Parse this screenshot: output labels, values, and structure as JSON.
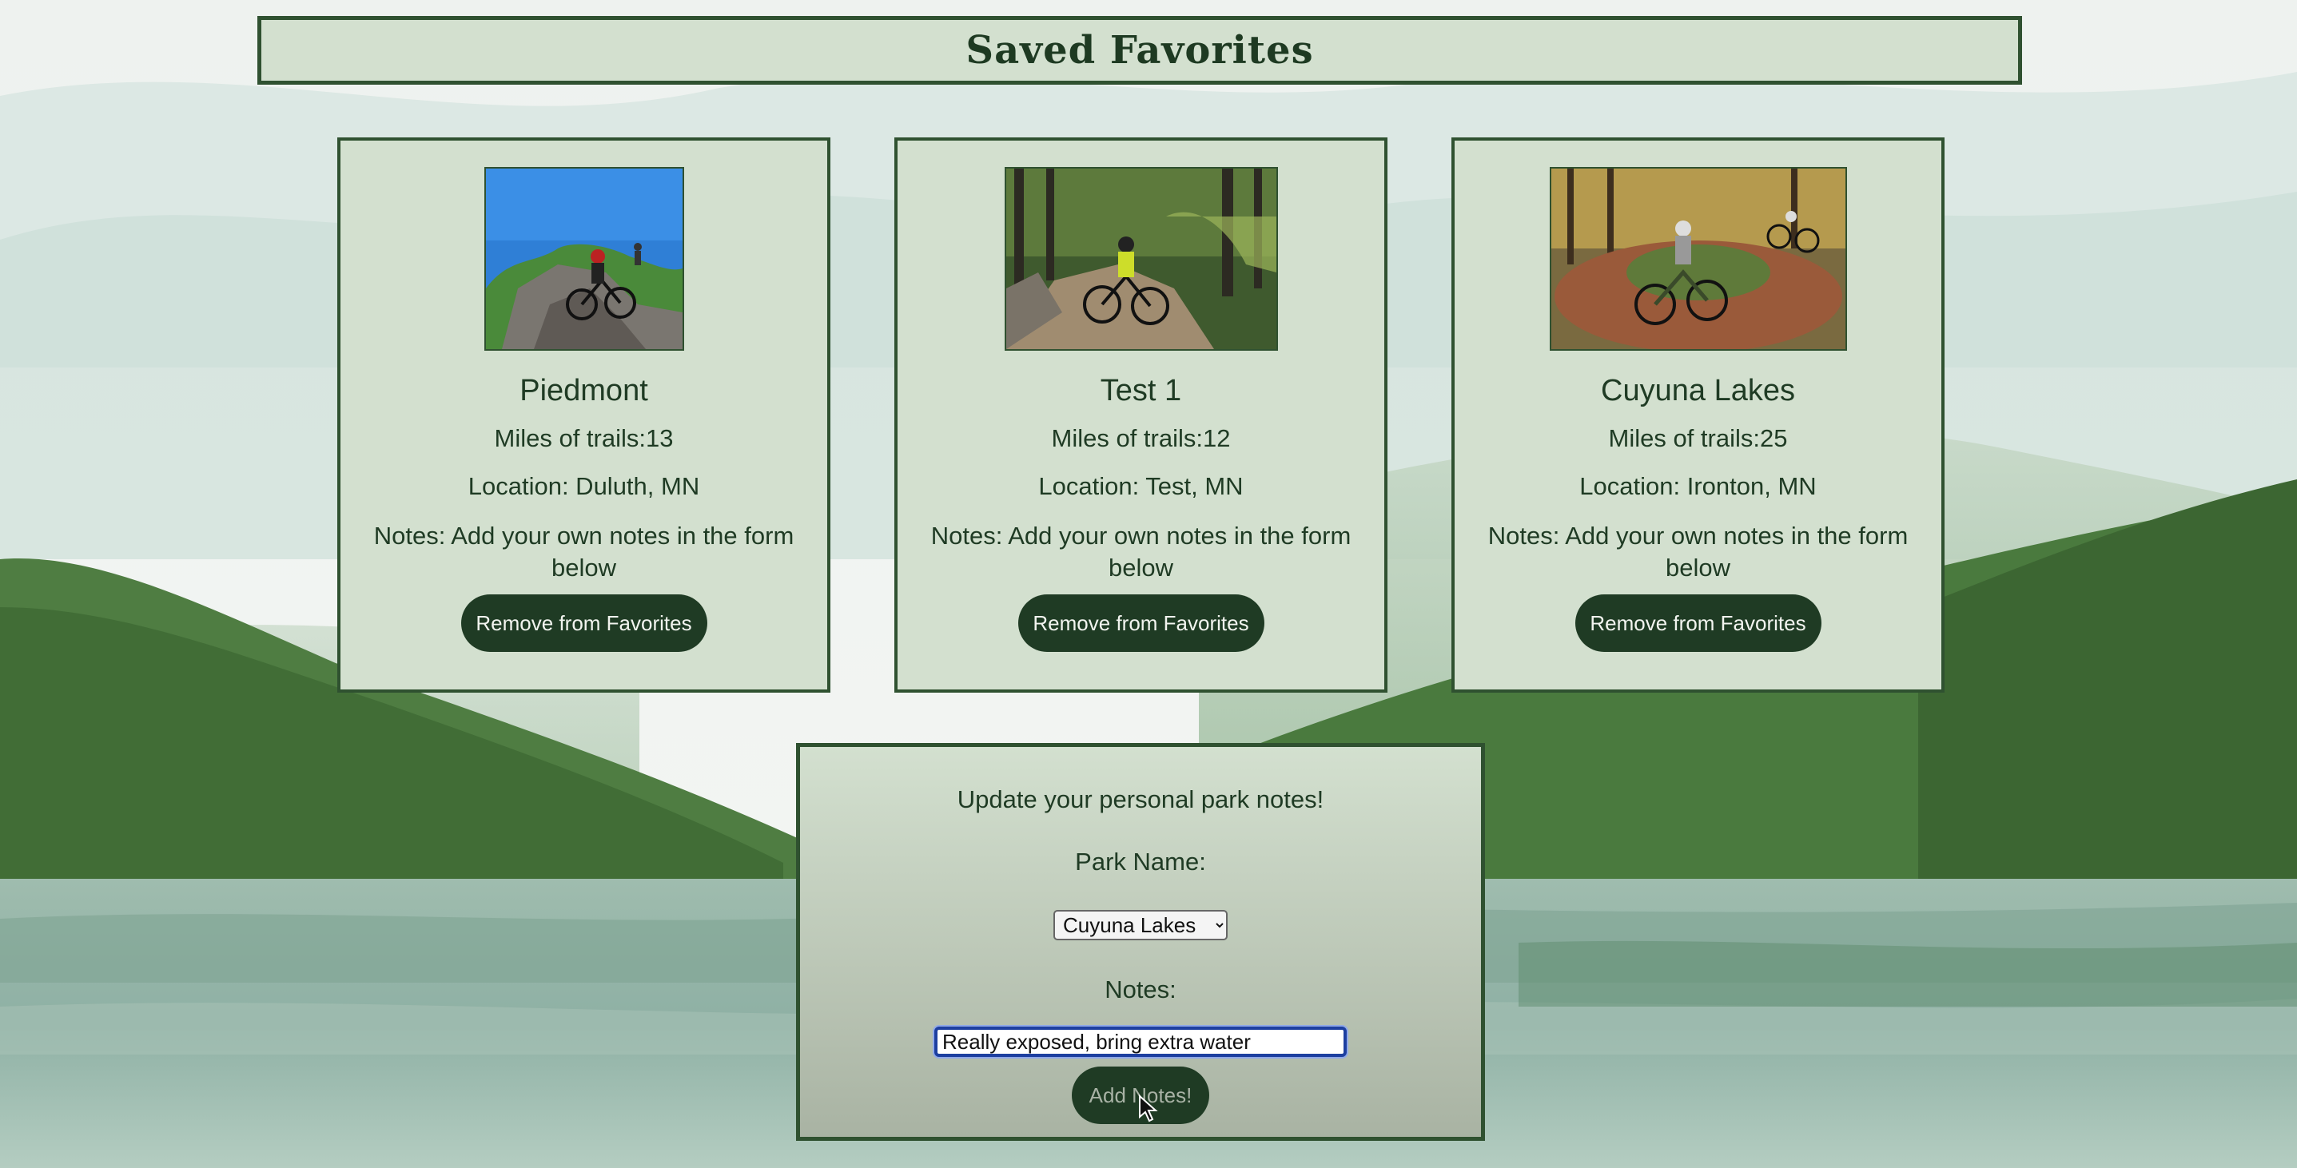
{
  "header": {
    "title": "Saved Favorites"
  },
  "cards": [
    {
      "name": "Piedmont",
      "miles": "Miles of trails:13",
      "location": "Location: Duluth, MN",
      "notes": "Notes: Add your own notes in the form below",
      "remove_label": "Remove from Favorites",
      "photo": "mountain-biker-on-rocks"
    },
    {
      "name": "Test 1",
      "miles": "Miles of trails:12",
      "location": "Location: Test, MN",
      "notes": "Notes: Add your own notes in the form below",
      "remove_label": "Remove from Favorites",
      "photo": "mountain-biker-forest-trail"
    },
    {
      "name": "Cuyuna Lakes",
      "miles": "Miles of trails:25",
      "location": "Location: Ironton, MN",
      "notes": "Notes: Add your own notes in the form below",
      "remove_label": "Remove from Favorites",
      "photo": "mountain-bikers-berm-turn"
    }
  ],
  "form": {
    "title": "Update your personal park notes!",
    "park_label": "Park Name:",
    "park_selected": "Cuyuna Lakes",
    "notes_label": "Notes:",
    "notes_value": "Really exposed, bring extra water",
    "submit_label": "Add Notes!"
  },
  "colors": {
    "panel_bg": "#d3e0cf",
    "border": "#2f5130",
    "button_bg": "#1f3b24",
    "text": "#1f3b24"
  }
}
